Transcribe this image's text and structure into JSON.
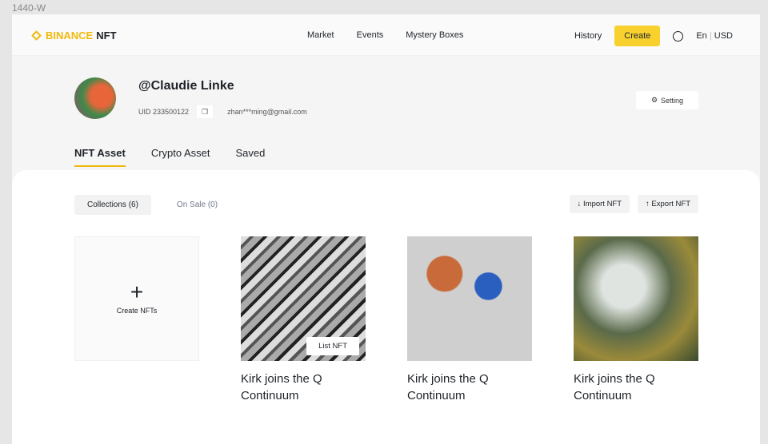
{
  "frame_label": "1440-W",
  "nav": {
    "logo_brand": "BINANCE",
    "logo_suffix": "NFT",
    "menu": [
      "Market",
      "Events",
      "Mystery Boxes"
    ],
    "history": "History",
    "create": "Create",
    "lang": "En",
    "currency": "USD",
    "brand_color": "#f0b90b"
  },
  "profile": {
    "name": "@Claudie Linke",
    "uid": "UID 233500122",
    "email": "zhan***ming@gmail.com",
    "setting": "Setting"
  },
  "tabs": [
    "NFT Asset",
    "Crypto Asset",
    "Saved"
  ],
  "subtabs": [
    "Collections (6)",
    "On Sale (0)"
  ],
  "actions": {
    "import": "↓ Import NFT",
    "export": "↑ Export NFT"
  },
  "create_card": {
    "label": "Create NFTs",
    "icon": "plus-icon"
  },
  "nfts": [
    {
      "title": "Kirk joins the Q Continuum",
      "list_label": "List NFT"
    },
    {
      "title": "Kirk joins the Q Continuum"
    },
    {
      "title": "Kirk joins the Q Continuum"
    }
  ]
}
